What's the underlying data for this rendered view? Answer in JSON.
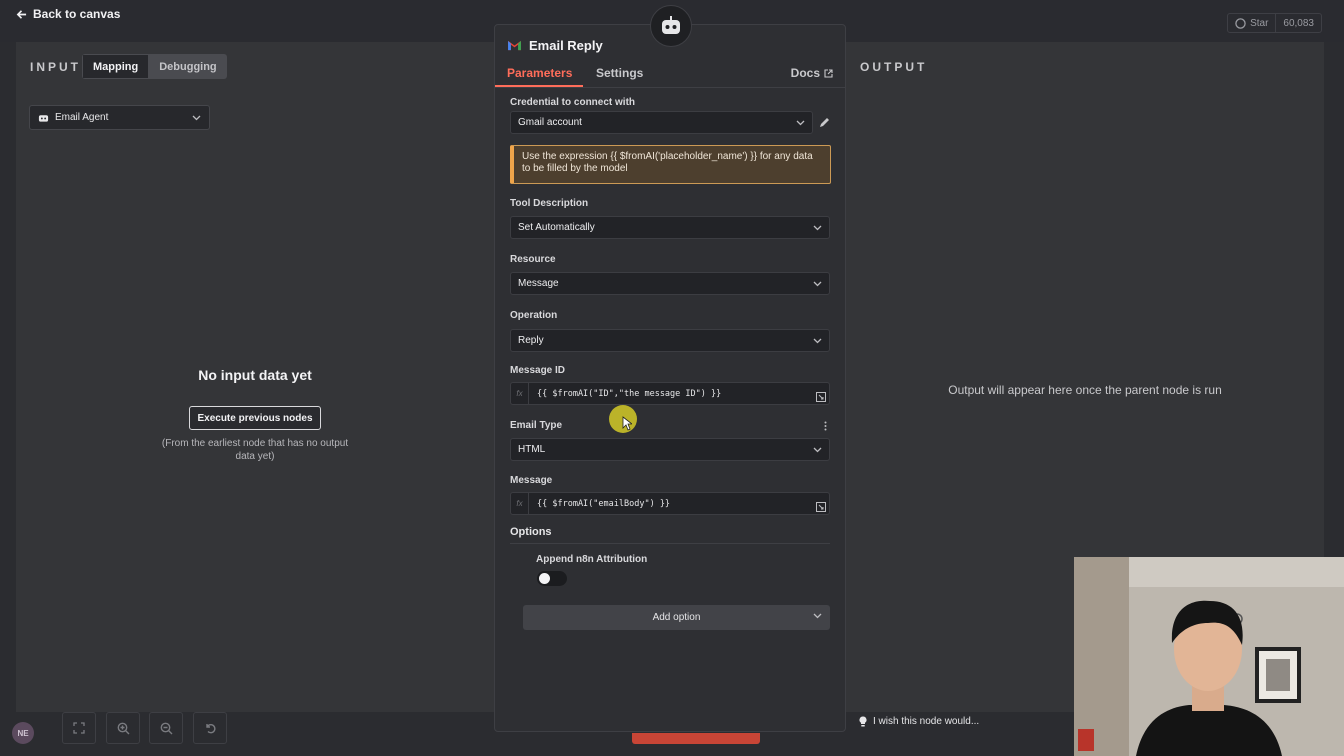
{
  "topbar": {
    "back_label": "Back to canvas",
    "github_star": "Star",
    "github_count": "60,083"
  },
  "input_panel": {
    "title": "INPUT",
    "tabs": [
      {
        "label": "Mapping",
        "active": true
      },
      {
        "label": "Debugging",
        "active": false
      }
    ],
    "source_node": "Email Agent",
    "empty_title": "No input data yet",
    "execute_button": "Execute previous nodes",
    "execute_note": "(From the earliest node that has no output data yet)"
  },
  "node": {
    "title": "Email Reply",
    "tabs": [
      {
        "label": "Parameters",
        "active": true
      },
      {
        "label": "Settings",
        "active": false
      }
    ],
    "docs_label": "Docs",
    "credential_label": "Credential to connect with",
    "credential_value": "Gmail account",
    "notice": "Use the expression {{ $fromAI('placeholder_name') }} for any data to be filled by the model",
    "tool_description_label": "Tool Description",
    "tool_description_value": "Set Automatically",
    "resource_label": "Resource",
    "resource_value": "Message",
    "operation_label": "Operation",
    "operation_value": "Reply",
    "message_id_label": "Message ID",
    "message_id_value": "{{ $fromAI(\"ID\",\"the message ID\") }}",
    "email_type_label": "Email Type",
    "email_type_value": "HTML",
    "message_label": "Message",
    "message_value": "{{ $fromAI(\"emailBody\") }}",
    "options_label": "Options",
    "append_attribution_label": "Append n8n Attribution",
    "append_attribution_on": false,
    "add_option_label": "Add option",
    "fx_label": "fx"
  },
  "output_panel": {
    "title": "OUTPUT",
    "empty_message": "Output will appear here once the parent node is run"
  },
  "footer": {
    "avatar_initials": "NE",
    "wish_label": "I wish this node would..."
  },
  "colors": {
    "accent": "#ff6d5a",
    "notice_border": "#f0a54a",
    "panel_bg": "#343538"
  }
}
